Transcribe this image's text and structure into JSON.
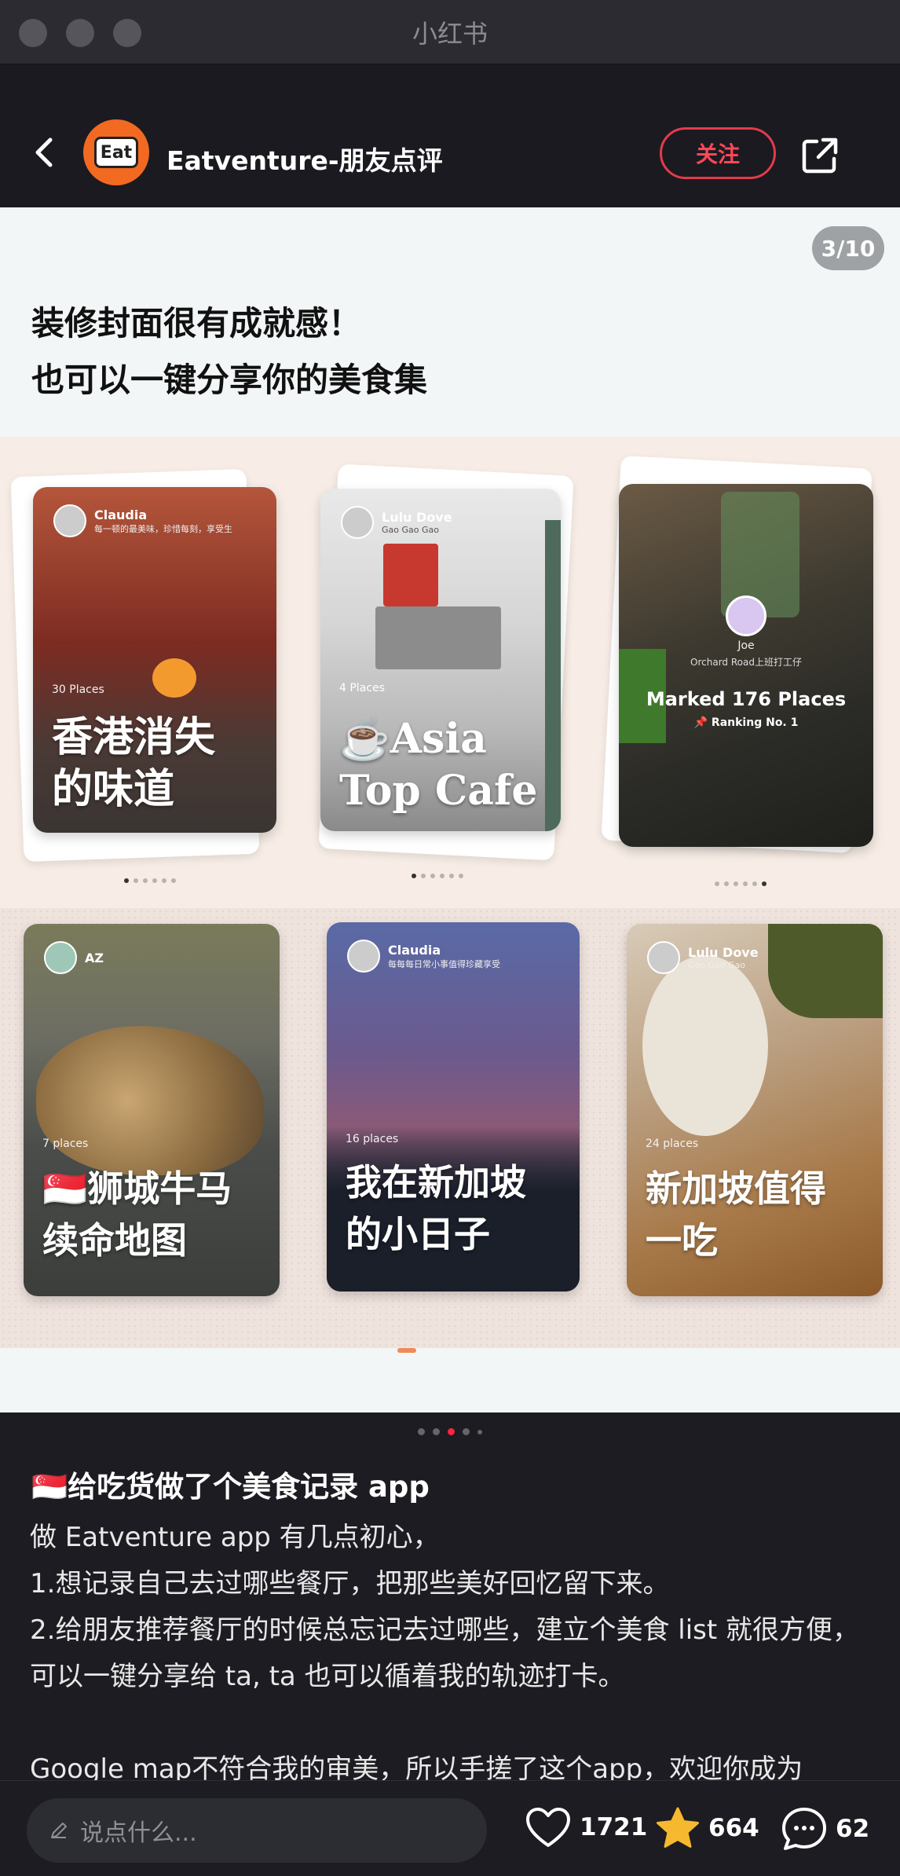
{
  "window": {
    "title": "小红书"
  },
  "header": {
    "account_name": "Eatventure-朋友点评",
    "avatar_text": "Eat",
    "follow_label": "关注"
  },
  "slide": {
    "counter": "3/10",
    "caption": "装修封面很有成就感！\n也可以一键分享你的美食集",
    "row1": [
      {
        "user": "Claudia",
        "sub": "每一顿的最美味，珍惜每刻，享受生",
        "places": "30 Places",
        "title": "香港消失\n的味道"
      },
      {
        "user": "Lulu Dove",
        "sub": "Gao Gao Gao",
        "places": "4 Places",
        "title": "☕Asia\nTop Cafe"
      },
      {
        "user": "Joe",
        "sub": "Orchard Road上班打工仔",
        "marked": "Marked 176 Places",
        "ranking": "📌 Ranking No. 1"
      }
    ],
    "row2": [
      {
        "user": "AZ",
        "places": "7 places",
        "title": "🇸🇬狮城牛马\n续命地图"
      },
      {
        "user": "Claudia",
        "sub": "每每每日常小事值得珍藏享受",
        "places": "16 places",
        "title": "我在新加坡\n的小日子"
      },
      {
        "user": "Lulu Dove",
        "sub": "Gao Gao Gao",
        "places": "24 places",
        "title": "新加坡值得\n一吃"
      }
    ]
  },
  "post": {
    "title": "🇸🇬给吃货做了个美食记录 app",
    "body": [
      "做 Eatventure app 有几点初心，",
      "1.想记录自己去过哪些餐厅，把那些美好回忆留下来。",
      "2.给朋友推荐餐厅的时候总忘记去过哪些，建立个美食 list 就很方便，可以一键分享给 ta, ta 也可以循着我的轨迹打卡。",
      "",
      "Google map不符合我的审美，所以手搓了这个app，欢迎你成为"
    ]
  },
  "bottom": {
    "comment_placeholder": "说点什么...",
    "likes": "1721",
    "favorites": "664",
    "comments": "62"
  },
  "colors": {
    "accent": "#ff2442",
    "star": "#f5b82e",
    "avatar_bg": "#f26a21"
  }
}
